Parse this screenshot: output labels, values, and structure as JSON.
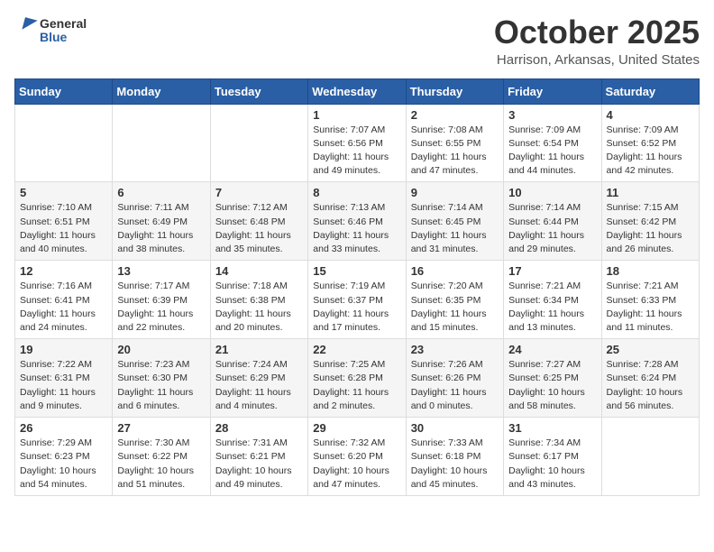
{
  "logo": {
    "text_general": "General",
    "text_blue": "Blue"
  },
  "title": "October 2025",
  "location": "Harrison, Arkansas, United States",
  "days_of_week": [
    "Sunday",
    "Monday",
    "Tuesday",
    "Wednesday",
    "Thursday",
    "Friday",
    "Saturday"
  ],
  "weeks": [
    [
      {
        "day": "",
        "info": ""
      },
      {
        "day": "",
        "info": ""
      },
      {
        "day": "",
        "info": ""
      },
      {
        "day": "1",
        "info": "Sunrise: 7:07 AM\nSunset: 6:56 PM\nDaylight: 11 hours and 49 minutes."
      },
      {
        "day": "2",
        "info": "Sunrise: 7:08 AM\nSunset: 6:55 PM\nDaylight: 11 hours and 47 minutes."
      },
      {
        "day": "3",
        "info": "Sunrise: 7:09 AM\nSunset: 6:54 PM\nDaylight: 11 hours and 44 minutes."
      },
      {
        "day": "4",
        "info": "Sunrise: 7:09 AM\nSunset: 6:52 PM\nDaylight: 11 hours and 42 minutes."
      }
    ],
    [
      {
        "day": "5",
        "info": "Sunrise: 7:10 AM\nSunset: 6:51 PM\nDaylight: 11 hours and 40 minutes."
      },
      {
        "day": "6",
        "info": "Sunrise: 7:11 AM\nSunset: 6:49 PM\nDaylight: 11 hours and 38 minutes."
      },
      {
        "day": "7",
        "info": "Sunrise: 7:12 AM\nSunset: 6:48 PM\nDaylight: 11 hours and 35 minutes."
      },
      {
        "day": "8",
        "info": "Sunrise: 7:13 AM\nSunset: 6:46 PM\nDaylight: 11 hours and 33 minutes."
      },
      {
        "day": "9",
        "info": "Sunrise: 7:14 AM\nSunset: 6:45 PM\nDaylight: 11 hours and 31 minutes."
      },
      {
        "day": "10",
        "info": "Sunrise: 7:14 AM\nSunset: 6:44 PM\nDaylight: 11 hours and 29 minutes."
      },
      {
        "day": "11",
        "info": "Sunrise: 7:15 AM\nSunset: 6:42 PM\nDaylight: 11 hours and 26 minutes."
      }
    ],
    [
      {
        "day": "12",
        "info": "Sunrise: 7:16 AM\nSunset: 6:41 PM\nDaylight: 11 hours and 24 minutes."
      },
      {
        "day": "13",
        "info": "Sunrise: 7:17 AM\nSunset: 6:39 PM\nDaylight: 11 hours and 22 minutes."
      },
      {
        "day": "14",
        "info": "Sunrise: 7:18 AM\nSunset: 6:38 PM\nDaylight: 11 hours and 20 minutes."
      },
      {
        "day": "15",
        "info": "Sunrise: 7:19 AM\nSunset: 6:37 PM\nDaylight: 11 hours and 17 minutes."
      },
      {
        "day": "16",
        "info": "Sunrise: 7:20 AM\nSunset: 6:35 PM\nDaylight: 11 hours and 15 minutes."
      },
      {
        "day": "17",
        "info": "Sunrise: 7:21 AM\nSunset: 6:34 PM\nDaylight: 11 hours and 13 minutes."
      },
      {
        "day": "18",
        "info": "Sunrise: 7:21 AM\nSunset: 6:33 PM\nDaylight: 11 hours and 11 minutes."
      }
    ],
    [
      {
        "day": "19",
        "info": "Sunrise: 7:22 AM\nSunset: 6:31 PM\nDaylight: 11 hours and 9 minutes."
      },
      {
        "day": "20",
        "info": "Sunrise: 7:23 AM\nSunset: 6:30 PM\nDaylight: 11 hours and 6 minutes."
      },
      {
        "day": "21",
        "info": "Sunrise: 7:24 AM\nSunset: 6:29 PM\nDaylight: 11 hours and 4 minutes."
      },
      {
        "day": "22",
        "info": "Sunrise: 7:25 AM\nSunset: 6:28 PM\nDaylight: 11 hours and 2 minutes."
      },
      {
        "day": "23",
        "info": "Sunrise: 7:26 AM\nSunset: 6:26 PM\nDaylight: 11 hours and 0 minutes."
      },
      {
        "day": "24",
        "info": "Sunrise: 7:27 AM\nSunset: 6:25 PM\nDaylight: 10 hours and 58 minutes."
      },
      {
        "day": "25",
        "info": "Sunrise: 7:28 AM\nSunset: 6:24 PM\nDaylight: 10 hours and 56 minutes."
      }
    ],
    [
      {
        "day": "26",
        "info": "Sunrise: 7:29 AM\nSunset: 6:23 PM\nDaylight: 10 hours and 54 minutes."
      },
      {
        "day": "27",
        "info": "Sunrise: 7:30 AM\nSunset: 6:22 PM\nDaylight: 10 hours and 51 minutes."
      },
      {
        "day": "28",
        "info": "Sunrise: 7:31 AM\nSunset: 6:21 PM\nDaylight: 10 hours and 49 minutes."
      },
      {
        "day": "29",
        "info": "Sunrise: 7:32 AM\nSunset: 6:20 PM\nDaylight: 10 hours and 47 minutes."
      },
      {
        "day": "30",
        "info": "Sunrise: 7:33 AM\nSunset: 6:18 PM\nDaylight: 10 hours and 45 minutes."
      },
      {
        "day": "31",
        "info": "Sunrise: 7:34 AM\nSunset: 6:17 PM\nDaylight: 10 hours and 43 minutes."
      },
      {
        "day": "",
        "info": ""
      }
    ]
  ]
}
